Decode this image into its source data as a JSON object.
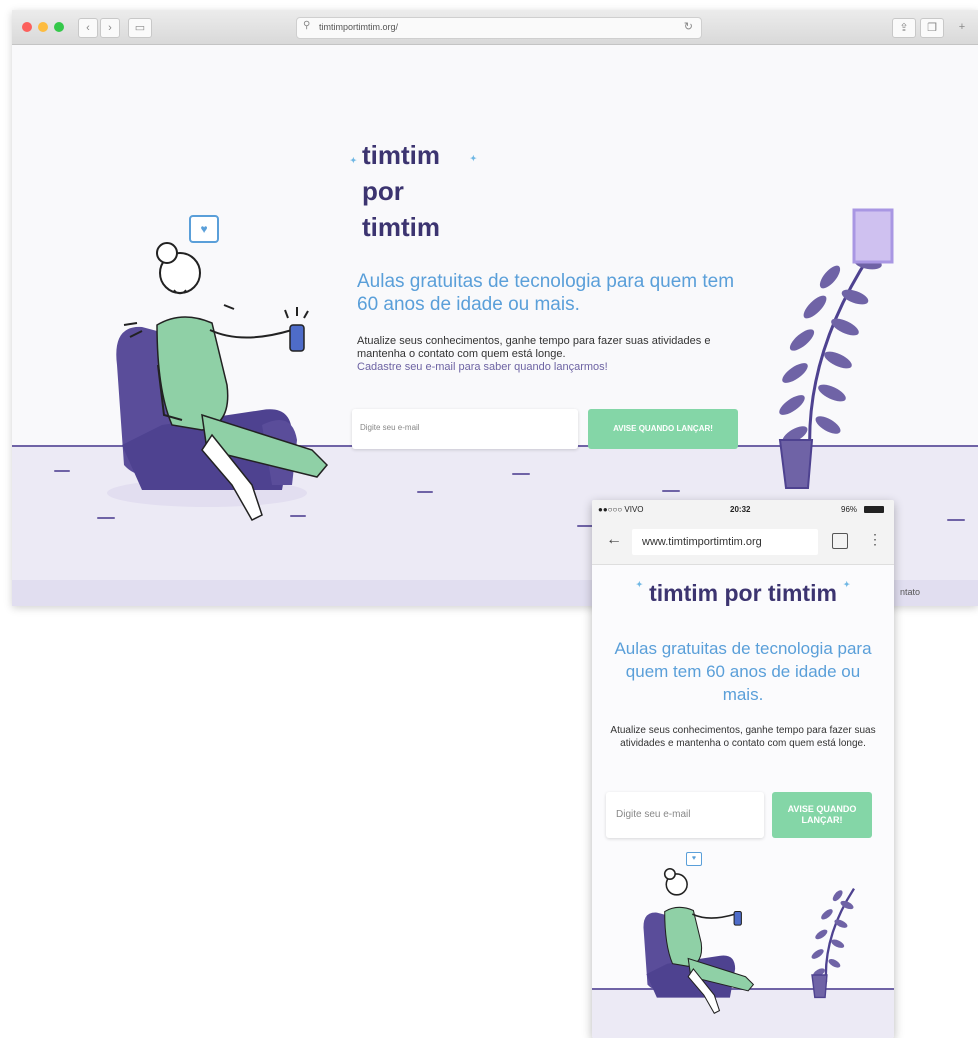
{
  "desktop": {
    "url": "timtimportimtim.org/",
    "logo_lines": [
      "timtim",
      "por",
      "timtim"
    ],
    "headline": "Aulas gratuitas de tecnologia para quem tem 60 anos de idade ou mais.",
    "description": "Atualize seus conhecimentos, ganhe tempo para fazer suas atividades e mantenha o contato com quem está longe.",
    "signup_prompt": "Cadastre seu e-mail para saber quando lançarmos!",
    "email_placeholder": "Digite seu e-mail",
    "cta_label": "AVISE QUANDO LANÇAR!",
    "footer_link": "ntato"
  },
  "mobile": {
    "carrier": "●●○○○ VIVO",
    "time": "20:32",
    "battery": "96%",
    "url": "www.timtimportimtim.org",
    "tabs_count": "",
    "logo": "timtim por timtim",
    "headline": "Aulas gratuitas de tecnologia para quem tem 60 anos de idade ou mais.",
    "description": "Atualize seus conhecimentos, ganhe tempo para fazer suas atividades e mantenha o contato com quem está longe.",
    "email_placeholder": "Digite seu e-mail",
    "cta_label": "AVISE QUANDO LANÇAR!"
  },
  "colors": {
    "brand_dark": "#3c3470",
    "headline_blue": "#5a9fd9",
    "cta_green": "#84d6a7",
    "illustration_purple": "#6f63a6",
    "dress_green": "#8fd0a6"
  }
}
